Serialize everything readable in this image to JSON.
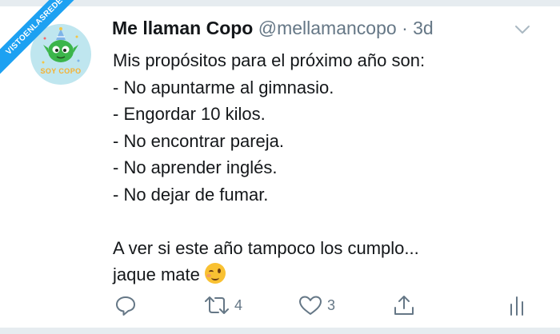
{
  "watermark": {
    "text": "VISTOENLASREDES"
  },
  "author": {
    "display_name": "Me llaman Copo",
    "handle": "@mellamancopo",
    "separator": "·",
    "time": "3d",
    "avatar_text": "SOY COPO"
  },
  "tweet": {
    "lines": [
      "Mis propósitos para el próximo año son:",
      "- No apuntarme al gimnasio.",
      "- Engordar 10 kilos.",
      "- No encontrar pareja.",
      "- No aprender inglés.",
      "- No dejar de fumar."
    ],
    "closing_line_1": "A ver si este año tampoco los cumplo...",
    "closing_line_2": "jaque mate",
    "emoji": "winking-face"
  },
  "actions": {
    "reply_count": "",
    "retweet_count": "4",
    "like_count": "3"
  },
  "icons": [
    "caret-down-icon",
    "reply-icon",
    "retweet-icon",
    "like-icon",
    "share-icon",
    "analytics-icon"
  ],
  "colors": {
    "accent": "#1da1f2",
    "text": "#14171a",
    "secondary": "#657786",
    "avatar_bg": "#bfe6ef",
    "mascot": "#3bb54a"
  }
}
